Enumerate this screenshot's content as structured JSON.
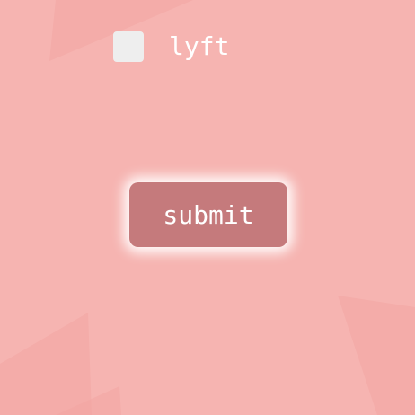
{
  "colors": {
    "background": "#f6b4b1",
    "shape": "#f2a5a2",
    "checkbox_fill": "#eeeeee",
    "button_fill": "#c57a7c",
    "glow": "#ffffff",
    "text": "#ffffff"
  },
  "checkbox": {
    "label": "lyft",
    "checked": false
  },
  "submit": {
    "label": "submit"
  }
}
